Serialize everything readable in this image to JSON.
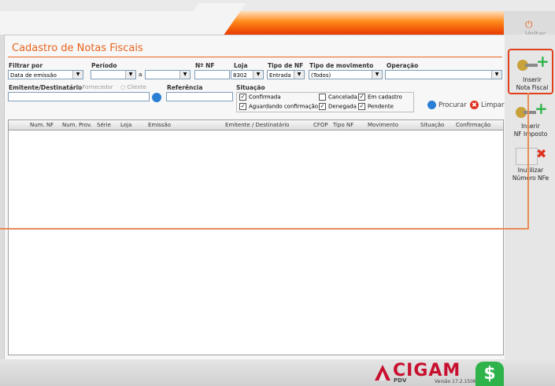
{
  "header": {
    "voltar_label": "Voltar"
  },
  "form": {
    "title": "Cadastro de Notas Fiscais",
    "filtrar_por_label": "Filtrar por",
    "filtrar_por_value": "Data de emissão",
    "periodo_label": "Período",
    "periodo_from": "",
    "periodo_sep": "a",
    "periodo_to": "",
    "nf_label": "Nº NF",
    "nf_value": "",
    "loja_label": "Loja",
    "loja_value": "8302",
    "tipo_nf_label": "Tipo de NF",
    "tipo_nf_value": "Entrada",
    "tipo_mov_label": "Tipo de movimento",
    "tipo_mov_value": "(Todos)",
    "operacao_label": "Operação",
    "operacao_value": "",
    "emitente_label": "Emitente/Destinatário",
    "radio_fornecedor": "Fornecedor",
    "radio_cliente": "Cliente",
    "emitente_value": "",
    "referencia_label": "Referência",
    "referencia_value": "",
    "situacao_label": "Situação",
    "chk_confirmada": "Confirmada",
    "chk_cancelada": "Cancelada",
    "chk_em_cadastro": "Em cadastro",
    "chk_aguardando": "Aguardando confirmação",
    "chk_denegada": "Denegada",
    "chk_pendente": "Pendente",
    "procurar_label": "Procurar",
    "limpar_label": "Limpar"
  },
  "grid": {
    "columns": [
      "Num. NF",
      "Num. Prov.",
      "Série",
      "Loja",
      "Emissão",
      "Emitente / Destinatário",
      "CFOP",
      "Tipo NF",
      "Movimento",
      "Situação",
      "Confirmação"
    ],
    "rows": []
  },
  "sidebar": {
    "inserir_nf_line1": "Inserir",
    "inserir_nf_line2": "Nota Fiscal",
    "inserir_imp_line1": "Inserir",
    "inserir_imp_line2": "NF Imposto",
    "inutilizar_line1": "Inutilizar",
    "inutilizar_line2": "Número NFe"
  },
  "footer": {
    "brand": "CIGAM",
    "sub": "PDV",
    "version": "Versão 17.2.1506"
  },
  "colors": {
    "accent": "#e8641e",
    "brand_red": "#c8102e",
    "green": "#2db34a"
  }
}
